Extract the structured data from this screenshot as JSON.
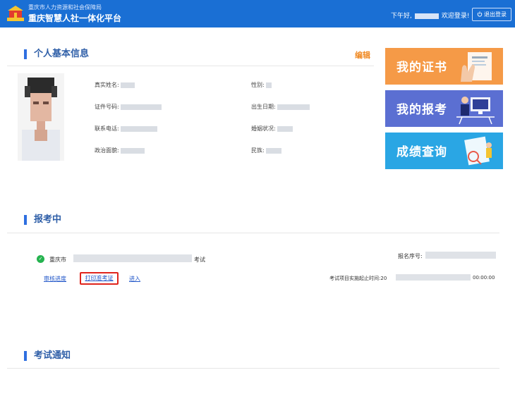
{
  "header": {
    "org_name": "重庆市人力资源和社会保障局",
    "platform_name": "重庆智慧人社一体化平台",
    "greeting_prefix": "下午好,",
    "greeting_suffix": "欢迎登录!",
    "logout_label": "退出登录",
    "brand_color": "#1a6fd4"
  },
  "profile": {
    "section_title": "个人基本信息",
    "edit_label": "编辑",
    "fields": {
      "real_name": "真实姓名:",
      "gender": "性别:",
      "id_number": "证件号码:",
      "birth_date": "出生日期:",
      "phone": "联系电话:",
      "marital_status": "婚姻状况:",
      "political_status": "政治面貌:",
      "ethnicity": "民族:"
    }
  },
  "cards": [
    {
      "label": "我的证书",
      "color": "#f59a47",
      "icon": "certificate-icon"
    },
    {
      "label": "我的报考",
      "color": "#5b6fd2",
      "icon": "computer-user-icon"
    },
    {
      "label": "成绩查询",
      "color": "#2aa6e4",
      "icon": "search-results-icon"
    }
  ],
  "registration": {
    "section_title": "报考中",
    "exam_city": "重庆市",
    "exam_suffix": "考试",
    "reg_number_label": "报名序号:",
    "links": {
      "review_progress": "审核进度",
      "print_admission": "打印准考证",
      "enter": "进入"
    },
    "period_label": "考试项目实施起止时间:",
    "period_start_prefix": "20",
    "period_end": "00:00:00"
  },
  "notice": {
    "section_title": "考试通知"
  }
}
